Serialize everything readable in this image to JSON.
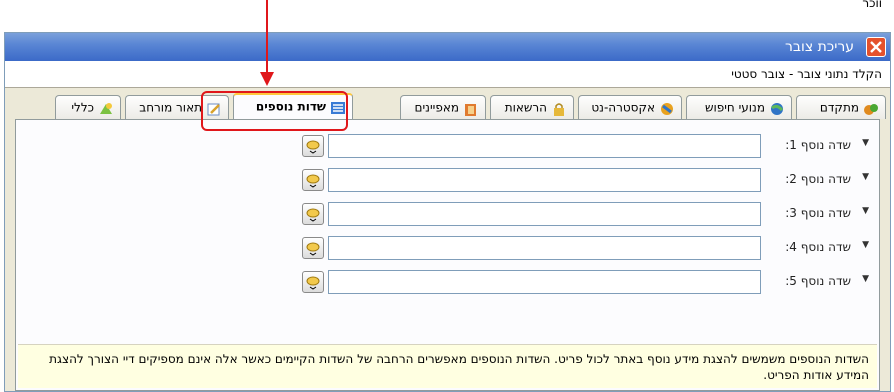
{
  "top_cut_text": "ווכר",
  "window": {
    "title": "עריכת צובר",
    "subtitle": "הקלד נתוני צובר - צובר סטטי"
  },
  "tabs": [
    {
      "label": "מתקדם",
      "icon": "advanced-icon"
    },
    {
      "label": "מנועי חיפוש",
      "icon": "globe-icon"
    },
    {
      "label": "אקסטרה-נט",
      "icon": "extranet-icon"
    },
    {
      "label": "הרשאות",
      "icon": "lock-icon"
    },
    {
      "label": "מאפיינים",
      "icon": "properties-icon"
    },
    {
      "label": "שדות נוספים",
      "icon": "fields-icon",
      "active": true
    },
    {
      "label": "תאור מורחב",
      "icon": "edit-icon"
    },
    {
      "label": "כללי",
      "icon": "general-icon"
    }
  ],
  "fields": [
    {
      "label": "שדה נוסף 1:",
      "value": ""
    },
    {
      "label": "שדה נוסף 2:",
      "value": ""
    },
    {
      "label": "שדה נוסף 3:",
      "value": ""
    },
    {
      "label": "שדה נוסף 4:",
      "value": ""
    },
    {
      "label": "שדה נוסף 5:",
      "value": ""
    }
  ],
  "help_text": "השדות הנוספים משמשים להצגת מידע נוסף באתר לכול פריט. השדות הנוספים מאפשרים הרחבה של השדות הקיימים כאשר אלה אינם מספיקים דיי הצורך להצגת המידע אודות הפריט.",
  "colors": {
    "annotation": "#e0171b",
    "titlebar": "#3b6ac8",
    "help_bg": "#ffffe1"
  }
}
